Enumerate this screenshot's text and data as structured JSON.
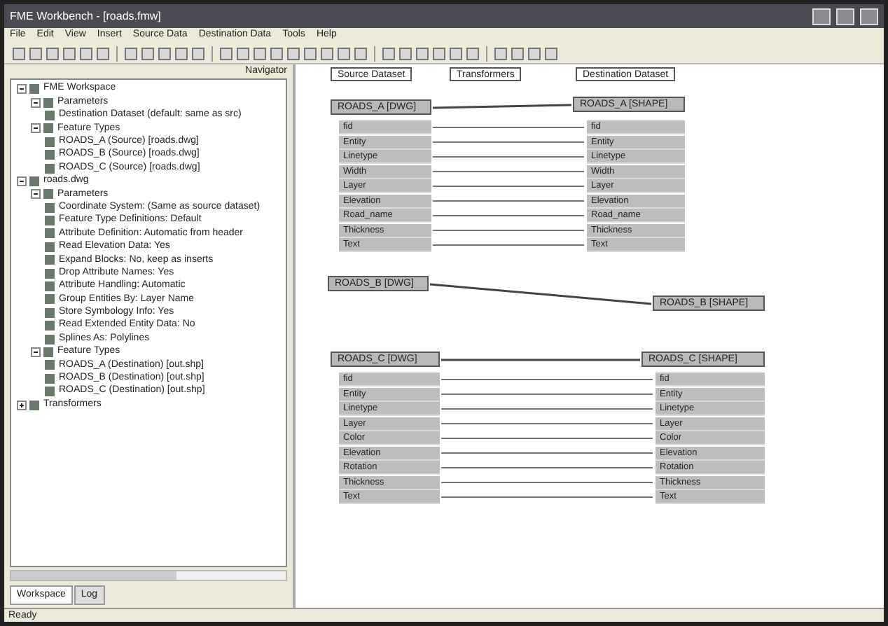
{
  "window": {
    "title": "FME Workbench - [roads.fmw]"
  },
  "menu": [
    "File",
    "Edit",
    "View",
    "Insert",
    "Source Data",
    "Destination Data",
    "Tools",
    "Help"
  ],
  "navigator": {
    "title": "Navigator",
    "tree": [
      {
        "label": "FME Workspace",
        "expanded": true,
        "children": [
          {
            "label": "Parameters",
            "expanded": true,
            "children": [
              {
                "label": "Destination Dataset (default: same as src)"
              }
            ]
          },
          {
            "label": "Feature Types",
            "expanded": true,
            "children": [
              {
                "label": "ROADS_A (Source) [roads.dwg]"
              },
              {
                "label": "ROADS_B (Source) [roads.dwg]"
              },
              {
                "label": "ROADS_C (Source) [roads.dwg]"
              }
            ]
          }
        ]
      },
      {
        "label": "roads.dwg",
        "expanded": true,
        "children": [
          {
            "label": "Parameters",
            "expanded": true,
            "children": [
              {
                "label": "Coordinate System: (Same as source dataset)"
              },
              {
                "label": "Feature Type Definitions: Default"
              },
              {
                "label": "Attribute Definition: Automatic from header"
              },
              {
                "label": "Read Elevation Data: Yes"
              },
              {
                "label": "Expand Blocks: No, keep as inserts"
              },
              {
                "label": "Drop Attribute Names: Yes"
              },
              {
                "label": "Attribute Handling: Automatic"
              },
              {
                "label": "Group Entities By: Layer Name"
              },
              {
                "label": "Store Symbology Info: Yes"
              },
              {
                "label": "Read Extended Entity Data: No"
              },
              {
                "label": "Splines As: Polylines"
              }
            ]
          },
          {
            "label": "Feature Types",
            "expanded": true,
            "children": [
              {
                "label": "ROADS_A (Destination) [out.shp]"
              },
              {
                "label": "ROADS_B (Destination) [out.shp]"
              },
              {
                "label": "ROADS_C (Destination) [out.shp]"
              }
            ]
          }
        ]
      },
      {
        "label": "Transformers",
        "expanded": false
      }
    ]
  },
  "bookmarks": [
    "Source Dataset",
    "Transformers",
    "Destination Dataset"
  ],
  "flows": [
    {
      "source": {
        "name": "ROADS_A [DWG]",
        "attributes": [
          "fid",
          "Entity",
          "Linetype",
          "Width",
          "Layer",
          "Elevation",
          "Road_name",
          "Thickness",
          "Text"
        ]
      },
      "destination": {
        "name": "ROADS_A [SHAPE]",
        "attributes": [
          "fid",
          "Entity",
          "Linetype",
          "Width",
          "Layer",
          "Elevation",
          "Road_name",
          "Thickness",
          "Text"
        ]
      }
    },
    {
      "source": {
        "name": "ROADS_B [DWG]"
      },
      "destination": {
        "name": "ROADS_B [SHAPE]"
      }
    },
    {
      "source": {
        "name": "ROADS_C [DWG]",
        "attributes": [
          "fid",
          "Entity",
          "Linetype",
          "Layer",
          "Color",
          "Elevation",
          "Rotation",
          "Thickness",
          "Text"
        ]
      },
      "destination": {
        "name": "ROADS_C [SHAPE]",
        "attributes": [
          "fid",
          "Entity",
          "Linetype",
          "Layer",
          "Color",
          "Elevation",
          "Rotation",
          "Thickness",
          "Text"
        ]
      }
    }
  ],
  "bottom_tabs": [
    {
      "label": "Workspace",
      "selected": true
    },
    {
      "label": "Log",
      "selected": false
    }
  ],
  "status_bar": "Ready"
}
